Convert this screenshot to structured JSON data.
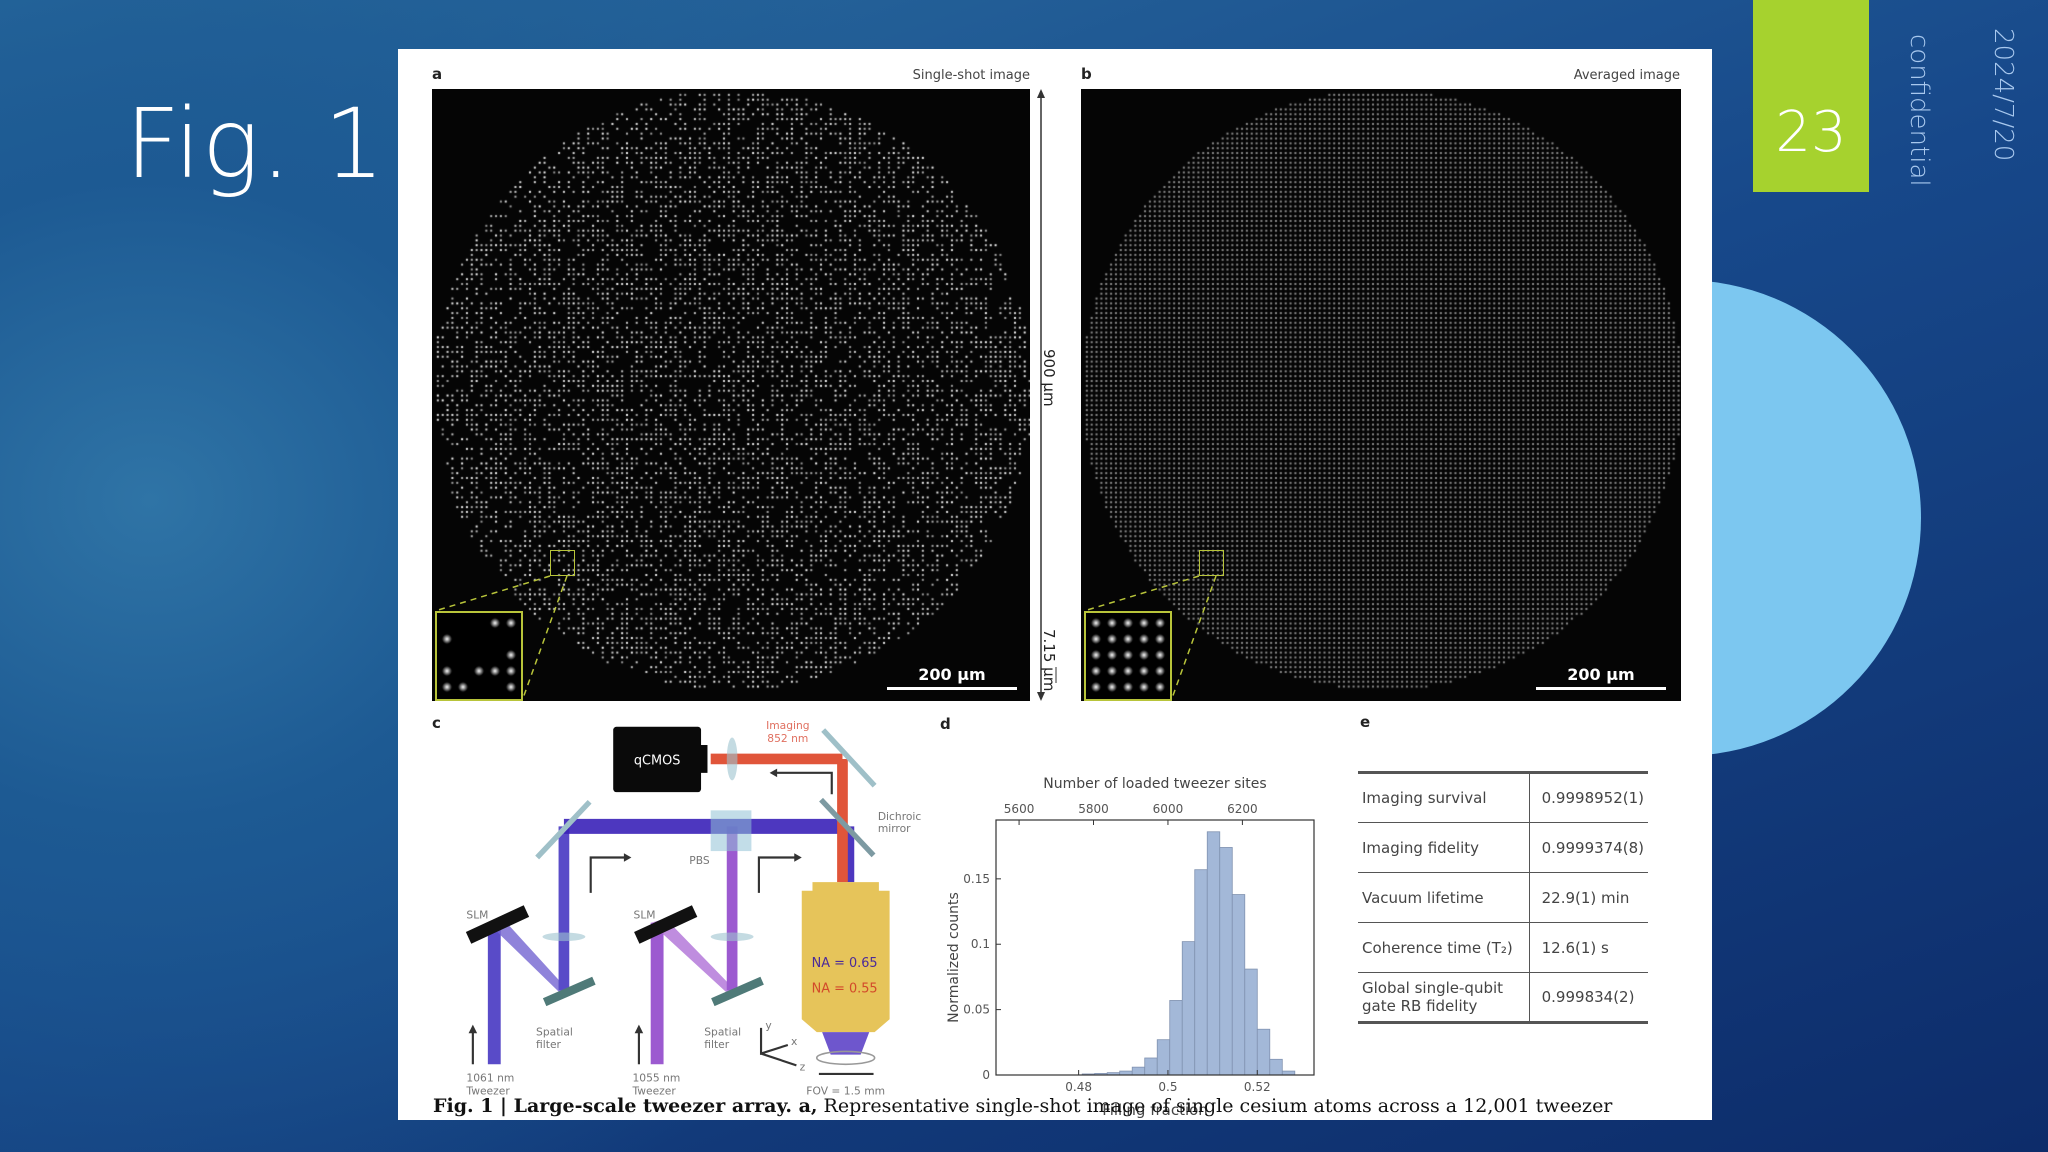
{
  "slide": {
    "title": "Fig. 1",
    "page_number": "23",
    "confidential": "confidential",
    "date": "2024/7/20"
  },
  "colors": {
    "accent_green": "#a6d22e",
    "circle": "#7cc7f0",
    "inset_border": "#b8c43a",
    "bar": "#a3b8d8"
  },
  "panel_a": {
    "label": "a",
    "title": "Single-shot image",
    "scale": "200 µm"
  },
  "panel_b": {
    "label": "b",
    "title": "Averaged image",
    "scale": "200 µm"
  },
  "dimension": {
    "height": "900 µm",
    "spacing": "7.15 µm"
  },
  "panel_c": {
    "label": "c",
    "camera": "qCMOS",
    "imaging": "Imaging",
    "imaging_wl": "852 nm",
    "dichroic": "Dichroic",
    "dichroic2": "mirror",
    "pbs": "PBS",
    "slm1": "SLM",
    "slm2": "SLM",
    "filter1a": "Spatial",
    "filter1b": "filter",
    "filter2a": "Spatial",
    "filter2b": "filter",
    "tw1a": "1061 nm",
    "tw1b": "Tweezer",
    "tw2a": "1055 nm",
    "tw2b": "Tweezer",
    "na1": "NA = 0.65",
    "na2": "NA = 0.55",
    "fov": "FOV = 1.5 mm",
    "ax_x": "x",
    "ax_y": "y",
    "ax_z": "z"
  },
  "chart_data": {
    "type": "bar",
    "label": "d",
    "title": "Number of loaded tweezer sites",
    "xlabel": "Filling fraction",
    "ylabel": "Normalized counts",
    "xlim": [
      0.4615,
      0.5327
    ],
    "ylim": [
      0,
      0.195
    ],
    "xticks": [
      {
        "v": 0.48,
        "t": "0.48"
      },
      {
        "v": 0.5,
        "t": "0.5"
      },
      {
        "v": 0.52,
        "t": "0.52"
      }
    ],
    "yticks": [
      {
        "v": 0,
        "t": "0"
      },
      {
        "v": 0.05,
        "t": "0.05"
      },
      {
        "v": 0.1,
        "t": "0.1"
      },
      {
        "v": 0.15,
        "t": "0.15"
      }
    ],
    "top_ticks": [
      {
        "v": 5600,
        "t": "5600"
      },
      {
        "v": 5800,
        "t": "5800"
      },
      {
        "v": 6000,
        "t": "6000"
      },
      {
        "v": 6200,
        "t": "6200"
      }
    ],
    "top_scale_sites_per_fraction": 12000,
    "bin_width": 0.0028,
    "bin_starts": [
      0.4808,
      0.4836,
      0.4864,
      0.4892,
      0.492,
      0.4948,
      0.4976,
      0.5004,
      0.5032,
      0.506,
      0.5088,
      0.5116,
      0.5144,
      0.5172,
      0.52,
      0.5228,
      0.5256
    ],
    "values": [
      0.0008,
      0.0012,
      0.0018,
      0.003,
      0.006,
      0.013,
      0.027,
      0.057,
      0.102,
      0.157,
      0.186,
      0.174,
      0.138,
      0.081,
      0.035,
      0.012,
      0.003
    ]
  },
  "panel_e": {
    "label": "e",
    "rows": [
      {
        "name": "Imaging survival",
        "value": "0.9998952(1)"
      },
      {
        "name": "Imaging fidelity",
        "value": "0.9999374(8)"
      },
      {
        "name": "Vacuum lifetime",
        "value": "22.9(1) min"
      },
      {
        "name": "Coherence time (T₂)",
        "value": "12.6(1) s"
      },
      {
        "name": "Global single-qubit gate RB fidelity",
        "value": "0.999834(2)"
      }
    ]
  },
  "caption": {
    "lead": "Fig. 1 | Large-scale tweezer array. a,",
    "rest": " Representative single-shot image of single cesium atoms across a 12,001 tweezer"
  }
}
